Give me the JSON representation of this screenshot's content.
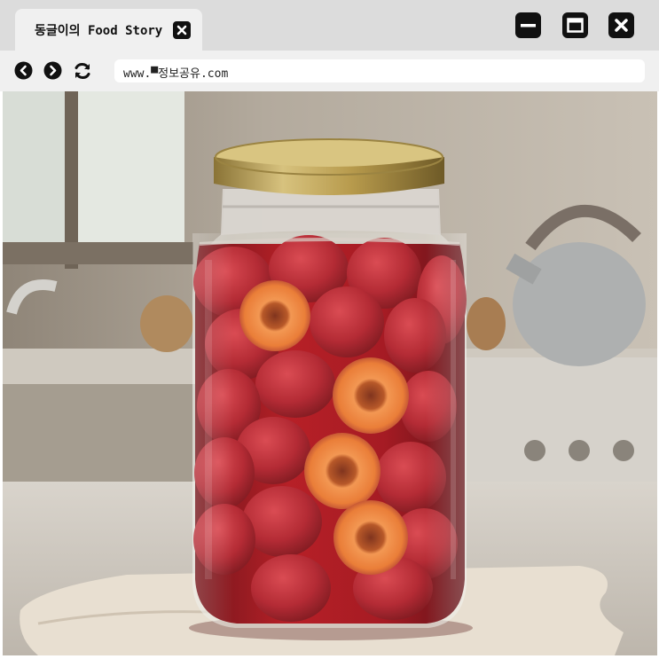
{
  "tab": {
    "title": "동글이의 Food Story",
    "close_icon": "close-icon"
  },
  "window_controls": {
    "minimize_icon": "minimize-icon",
    "maximize_icon": "maximize-icon",
    "close_icon": "close-icon"
  },
  "navigation": {
    "back_icon": "chevron-left-icon",
    "forward_icon": "chevron-right-icon",
    "reload_icon": "refresh-icon"
  },
  "address_bar": {
    "url": "www.▀정보공유.com"
  },
  "content": {
    "image_subject": "photo-jar-of-preserved-plums"
  },
  "colors": {
    "titlebar_bg": "#dcdcdc",
    "tab_bg": "#f0f0f0",
    "navbar_bg": "#f0f0f0",
    "icon_fg": "#111111",
    "address_bg": "#ffffff"
  }
}
